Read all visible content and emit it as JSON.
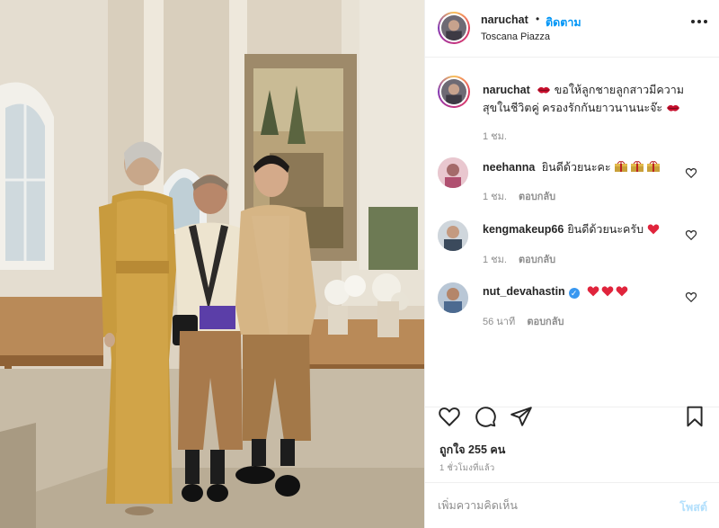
{
  "post": {
    "username": "naruchat",
    "separator": "•",
    "follow_label": "ติดตาม",
    "location": "Toscana Piazza",
    "more_icon": "more-horizontal-icon"
  },
  "caption": {
    "username": "naruchat",
    "line1": "ขอให้ลูกชายลูกสาวมีความ",
    "line2": "สุขในชีวิตคู่ ครองรักกันยาวนานนะจ๊ะ",
    "time": "1 ชม."
  },
  "comments": [
    {
      "username": "neehanna",
      "text": "ยินดีด้วยนะคะ",
      "time": "1 ชม.",
      "reply_label": "ตอบกลับ"
    },
    {
      "username": "kengmakeup66",
      "text": "ยินดีด้วยนะครับ",
      "time": "1 ชม.",
      "reply_label": "ตอบกลับ"
    },
    {
      "username": "nut_devahastin",
      "verified_mark": "✓",
      "text": "",
      "time": "56 นาที",
      "reply_label": "ตอบกลับ"
    }
  ],
  "actions": {
    "likes": "ถูกใจ 255 คน",
    "time_ago": "1 ชั่วโมงที่แล้ว",
    "icons": [
      "heart-icon",
      "comment-icon",
      "share-icon",
      "bookmark-icon"
    ]
  },
  "composer": {
    "placeholder": "เพิ่มความคิดเห็น",
    "post_label": "โพสต์"
  },
  "colors": {
    "link_blue": "#0095f6",
    "post_disabled": "#b2dffc",
    "heart_red": "#ed1c24",
    "secondary_text": "#8e8e8e"
  }
}
